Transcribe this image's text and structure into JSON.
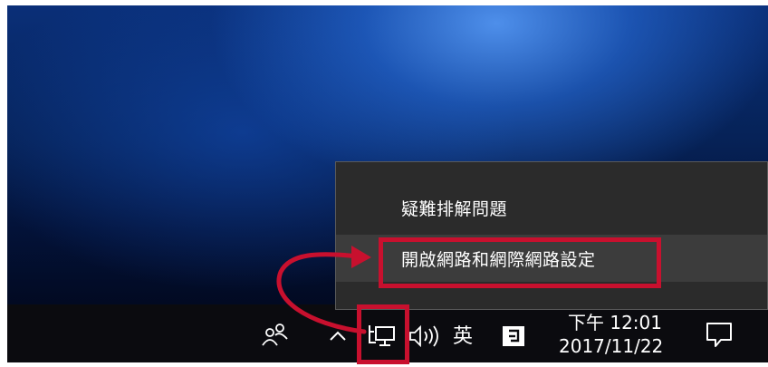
{
  "context_menu": {
    "items": [
      {
        "label": "疑難排解問題"
      },
      {
        "label": "開啟網路和網際網路設定"
      }
    ]
  },
  "taskbar": {
    "icons": {
      "people": "people-icon",
      "overflow": "chevron-up-icon",
      "network": "network-icon",
      "volume": "volume-icon",
      "ime": "英",
      "ime_mode": "ime-mode-icon",
      "action_center": "notification-icon"
    },
    "clock": {
      "time": "下午 12:01",
      "date": "2017/11/22"
    }
  },
  "annotation_color": "#c8102e"
}
